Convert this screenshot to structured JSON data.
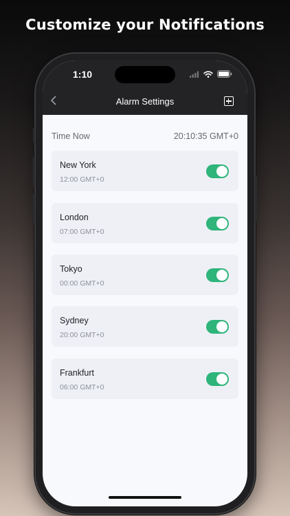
{
  "headline": "Customize your Notifications",
  "status": {
    "time": "1:10"
  },
  "nav": {
    "title": "Alarm Settings"
  },
  "time_now": {
    "label": "Time Now",
    "value": "20:10:35 GMT+0"
  },
  "alarms": [
    {
      "city": "New York",
      "time": "12:00 GMT+0",
      "enabled": true
    },
    {
      "city": "London",
      "time": "07:00 GMT+0",
      "enabled": true
    },
    {
      "city": "Tokyo",
      "time": "00:00 GMT+0",
      "enabled": true
    },
    {
      "city": "Sydney",
      "time": "20:00 GMT+0",
      "enabled": true
    },
    {
      "city": "Frankfurt",
      "time": "06:00 GMT+0",
      "enabled": true
    }
  ],
  "colors": {
    "toggle_on": "#2fb47a",
    "header_bg": "#232325",
    "card_bg": "#eef0f6"
  },
  "icons": {
    "back": "chevron-left-icon",
    "add": "plus-square-icon",
    "wifi": "wifi-icon",
    "battery": "battery-icon",
    "signal": "signal-icon"
  }
}
